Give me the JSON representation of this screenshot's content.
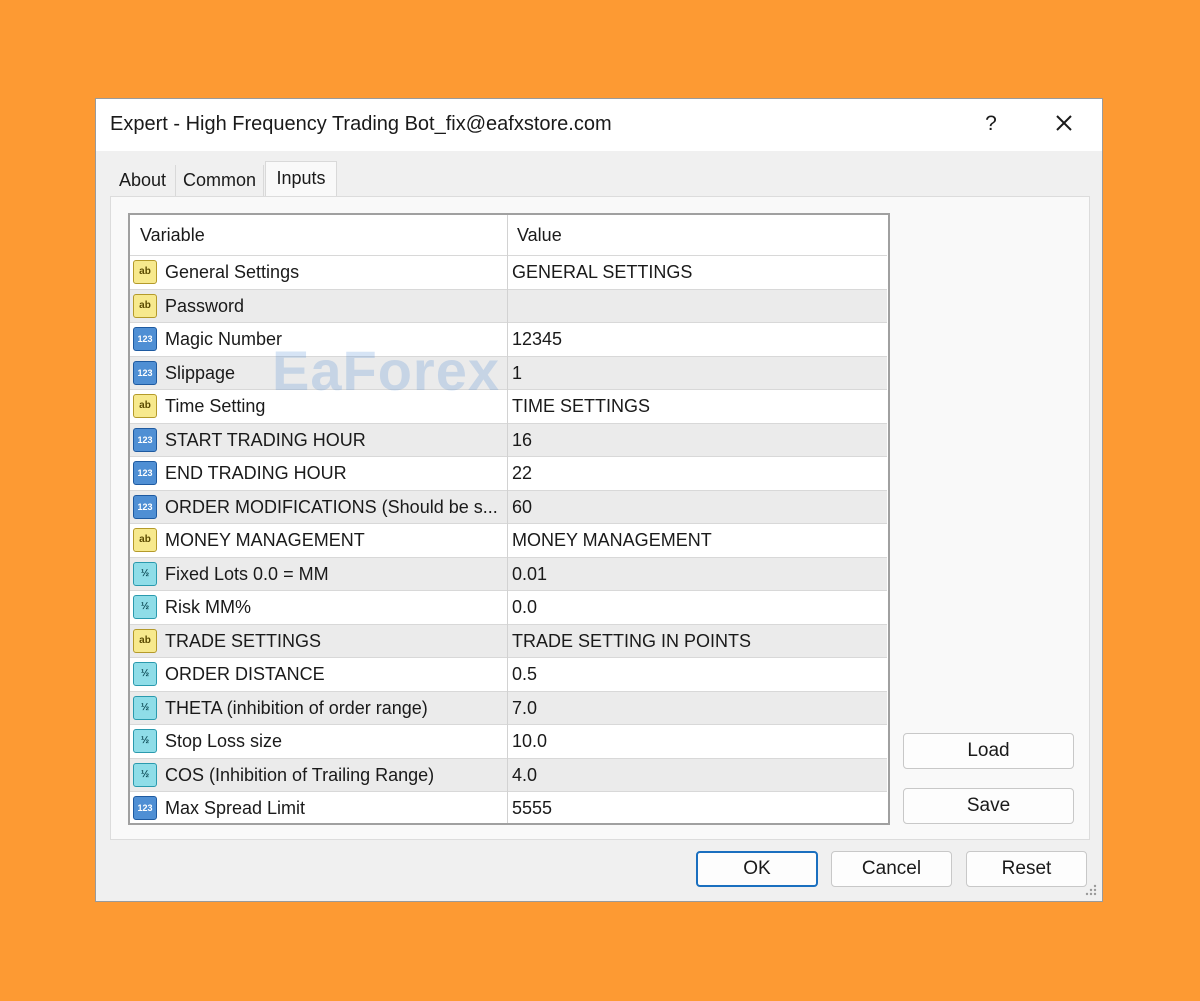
{
  "window": {
    "title": "Expert - High Frequency Trading Bot_fix@eafxstore.com",
    "help_label": "?"
  },
  "tabs": [
    {
      "label": "About"
    },
    {
      "label": "Common"
    },
    {
      "label": "Inputs"
    }
  ],
  "active_tab": "Inputs",
  "grid": {
    "headers": {
      "variable": "Variable",
      "value": "Value"
    },
    "rows": [
      {
        "type": "string",
        "icon_text": "ab",
        "variable": "General Settings",
        "value": "GENERAL SETTINGS"
      },
      {
        "type": "string",
        "icon_text": "ab",
        "variable": "Password",
        "value": ""
      },
      {
        "type": "int",
        "icon_text": "123",
        "variable": "Magic Number",
        "value": "12345"
      },
      {
        "type": "int",
        "icon_text": "123",
        "variable": "Slippage",
        "value": "1"
      },
      {
        "type": "string",
        "icon_text": "ab",
        "variable": "Time Setting",
        "value": "TIME SETTINGS"
      },
      {
        "type": "int",
        "icon_text": "123",
        "variable": "START TRADING HOUR",
        "value": "16"
      },
      {
        "type": "int",
        "icon_text": "123",
        "variable": "END TRADING HOUR",
        "value": "22"
      },
      {
        "type": "int",
        "icon_text": "123",
        "variable": "ORDER MODIFICATIONS (Should be s...",
        "value": "60"
      },
      {
        "type": "string",
        "icon_text": "ab",
        "variable": "MONEY MANAGEMENT",
        "value": "MONEY MANAGEMENT"
      },
      {
        "type": "double",
        "icon_text": "½",
        "variable": "Fixed Lots 0.0 = MM",
        "value": "0.01"
      },
      {
        "type": "double",
        "icon_text": "½",
        "variable": "Risk MM%",
        "value": "0.0"
      },
      {
        "type": "string",
        "icon_text": "ab",
        "variable": "TRADE SETTINGS",
        "value": "TRADE SETTING IN POINTS"
      },
      {
        "type": "double",
        "icon_text": "½",
        "variable": "ORDER DISTANCE",
        "value": "0.5"
      },
      {
        "type": "double",
        "icon_text": "½",
        "variable": "THETA (inhibition of order range)",
        "value": "7.0"
      },
      {
        "type": "double",
        "icon_text": "½",
        "variable": "Stop Loss size",
        "value": "10.0"
      },
      {
        "type": "double",
        "icon_text": "½",
        "variable": "COS (Inhibition of Trailing Range)",
        "value": "4.0"
      },
      {
        "type": "int",
        "icon_text": "123",
        "variable": "Max Spread Limit",
        "value": "5555"
      }
    ]
  },
  "side_buttons": {
    "load": "Load",
    "save": "Save"
  },
  "footer_buttons": {
    "ok": "OK",
    "cancel": "Cancel",
    "reset": "Reset"
  },
  "watermark": "EaForex",
  "colors": {
    "background": "#fd9a33",
    "dialog": "#f0f0f0",
    "primary_border": "#1a6fbf"
  }
}
